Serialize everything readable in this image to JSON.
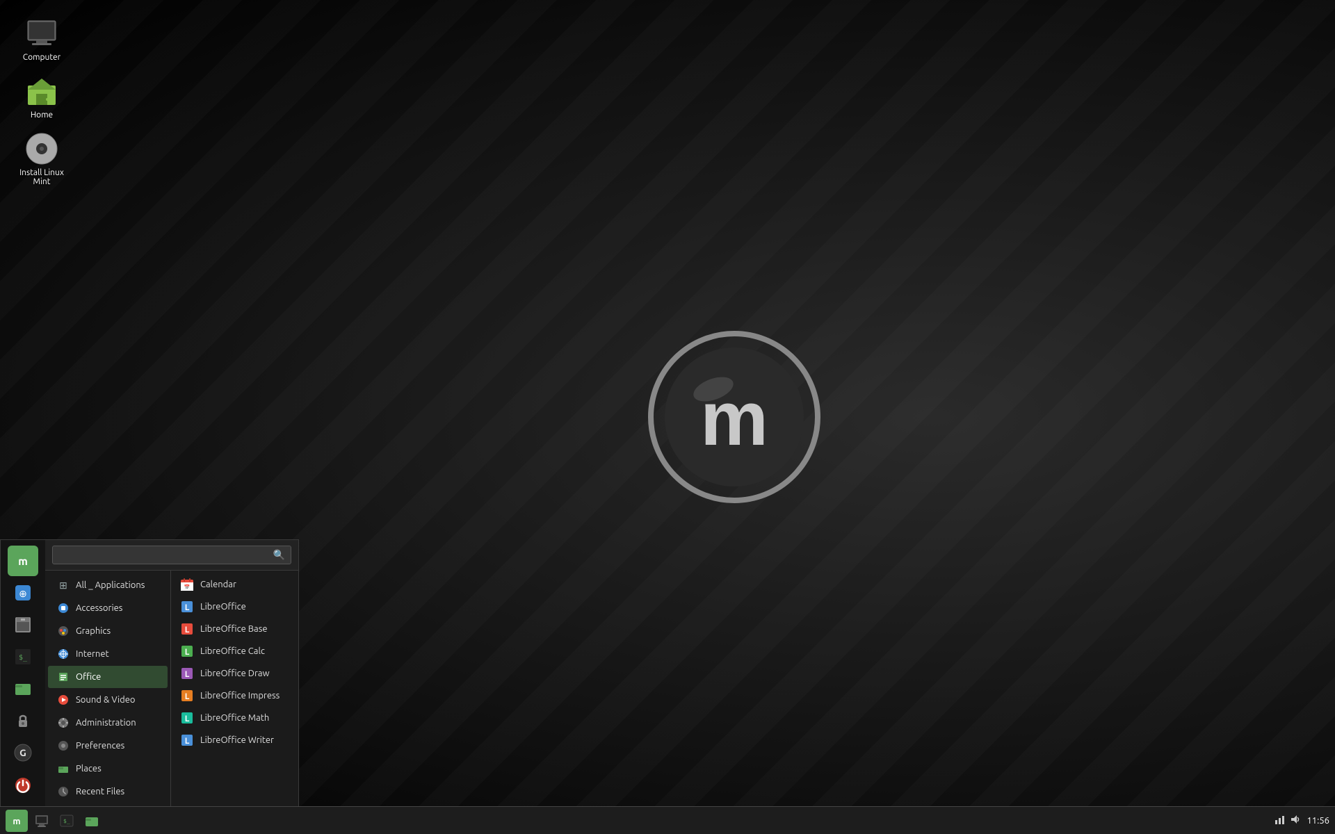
{
  "desktop": {
    "icons": [
      {
        "id": "computer",
        "label": "Computer",
        "icon": "🖥"
      },
      {
        "id": "home",
        "label": "Home",
        "icon": "🏠"
      },
      {
        "id": "install",
        "label": "Install Linux Mint",
        "icon": "💿"
      }
    ]
  },
  "taskbar": {
    "time": "11:56",
    "buttons": [
      {
        "id": "mint-menu",
        "icon": "🌿",
        "label": "Menu"
      },
      {
        "id": "show-desktop",
        "icon": "🖥",
        "label": "Show Desktop"
      },
      {
        "id": "terminal",
        "icon": "⬛",
        "label": "Terminal"
      },
      {
        "id": "files",
        "icon": "📁",
        "label": "Files"
      }
    ]
  },
  "start_menu": {
    "search": {
      "placeholder": "",
      "value": ""
    },
    "sidebar_icons": [
      {
        "id": "mint",
        "icon": "🌿",
        "color": "#5ba55b",
        "label": "Mint"
      },
      {
        "id": "software",
        "icon": "📦",
        "label": "Software Manager"
      },
      {
        "id": "package",
        "icon": "🗃",
        "label": "Package Manager"
      },
      {
        "id": "terminal-s",
        "icon": "⬛",
        "label": "Terminal"
      },
      {
        "id": "folder-s",
        "icon": "📁",
        "label": "Files"
      },
      {
        "id": "lock",
        "icon": "🔒",
        "label": "Lock Screen"
      },
      {
        "id": "gramps",
        "icon": "G",
        "label": "Gramps"
      },
      {
        "id": "power",
        "icon": "⏻",
        "label": "Power"
      }
    ],
    "categories": [
      {
        "id": "all",
        "label": "All _ Applications",
        "icon": "⊞",
        "active": false
      },
      {
        "id": "accessories",
        "label": "Accessories",
        "icon": "🔧",
        "active": false
      },
      {
        "id": "graphics",
        "label": "Graphics",
        "icon": "🎨",
        "active": false
      },
      {
        "id": "internet",
        "label": "Internet",
        "icon": "🌐",
        "active": false
      },
      {
        "id": "office",
        "label": "Office",
        "icon": "📄",
        "active": true
      },
      {
        "id": "sound-video",
        "label": "Sound & Video",
        "icon": "▶",
        "active": false
      },
      {
        "id": "administration",
        "label": "Administration",
        "icon": "⚙",
        "active": false
      },
      {
        "id": "preferences",
        "label": "Preferences",
        "icon": "🔧",
        "active": false
      },
      {
        "id": "places",
        "label": "Places",
        "icon": "📁",
        "active": false
      },
      {
        "id": "recent-files",
        "label": "Recent Files",
        "icon": "🕐",
        "active": false
      }
    ],
    "apps": [
      {
        "id": "calendar",
        "label": "Calendar",
        "icon": "📅",
        "color": "#e74c3c"
      },
      {
        "id": "libreoffice",
        "label": "LibreOffice",
        "icon": "L",
        "color": "#4a90d9"
      },
      {
        "id": "libreoffice-base",
        "label": "LibreOffice Base",
        "icon": "L",
        "color": "#e74c3c"
      },
      {
        "id": "libreoffice-calc",
        "label": "LibreOffice Calc",
        "icon": "L",
        "color": "#4caf50"
      },
      {
        "id": "libreoffice-draw",
        "label": "LibreOffice Draw",
        "icon": "L",
        "color": "#9b59b6"
      },
      {
        "id": "libreoffice-impress",
        "label": "LibreOffice Impress",
        "icon": "L",
        "color": "#e67e22"
      },
      {
        "id": "libreoffice-math",
        "label": "LibreOffice Math",
        "icon": "L",
        "color": "#1abc9c"
      },
      {
        "id": "libreoffice-writer",
        "label": "LibreOffice Writer",
        "icon": "L",
        "color": "#4a90d9"
      }
    ]
  }
}
